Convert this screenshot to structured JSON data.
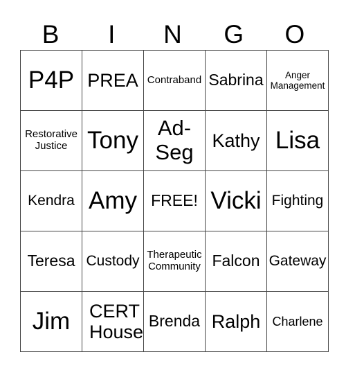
{
  "header": [
    "B",
    "I",
    "N",
    "G",
    "O"
  ],
  "rows": [
    [
      "P4P",
      "PREA",
      "Contraband",
      "Sabrina",
      "Anger Management"
    ],
    [
      "Restorative Justice",
      "Tony",
      "Ad-Seg",
      "Kathy",
      "Lisa"
    ],
    [
      "Kendra",
      "Amy",
      "FREE!",
      "Vicki",
      "Fighting"
    ],
    [
      "Teresa",
      "Custody",
      "Therapeutic Community",
      "Falcon",
      "Gateway"
    ],
    [
      "Jim",
      "CERT House",
      "Brenda",
      "Ralph",
      "Charlene"
    ]
  ]
}
